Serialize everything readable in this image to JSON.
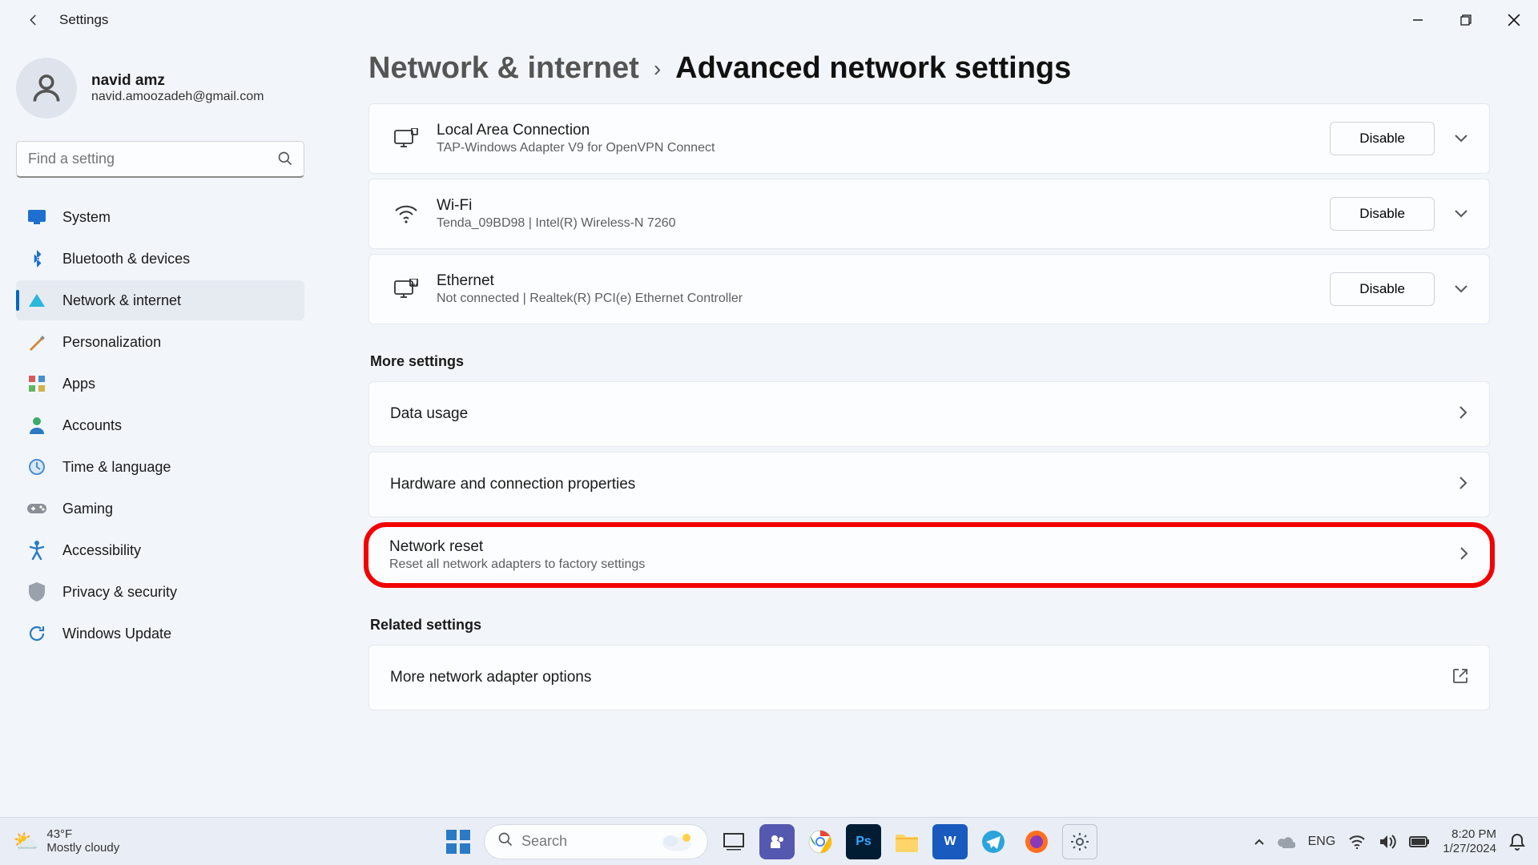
{
  "window": {
    "title": "Settings"
  },
  "profile": {
    "name": "navid amz",
    "email": "navid.amoozadeh@gmail.com"
  },
  "search": {
    "placeholder": "Find a setting"
  },
  "sidebar": {
    "items": [
      {
        "label": "System"
      },
      {
        "label": "Bluetooth & devices"
      },
      {
        "label": "Network & internet"
      },
      {
        "label": "Personalization"
      },
      {
        "label": "Apps"
      },
      {
        "label": "Accounts"
      },
      {
        "label": "Time & language"
      },
      {
        "label": "Gaming"
      },
      {
        "label": "Accessibility"
      },
      {
        "label": "Privacy & security"
      },
      {
        "label": "Windows Update"
      }
    ]
  },
  "breadcrumb": {
    "parent": "Network & internet",
    "current": "Advanced network settings"
  },
  "adapters": [
    {
      "title": "Local Area Connection",
      "subtitle": "TAP-Windows Adapter V9 for OpenVPN Connect",
      "action": "Disable"
    },
    {
      "title": "Wi-Fi",
      "subtitle": "Tenda_09BD98 | Intel(R) Wireless-N 7260",
      "action": "Disable"
    },
    {
      "title": "Ethernet",
      "subtitle": "Not connected | Realtek(R) PCI(e) Ethernet Controller",
      "action": "Disable"
    }
  ],
  "sections": {
    "more": "More settings",
    "related": "Related settings"
  },
  "more_rows": [
    {
      "title": "Data usage"
    },
    {
      "title": "Hardware and connection properties"
    },
    {
      "title": "Network reset",
      "subtitle": "Reset all network adapters to factory settings"
    }
  ],
  "related_rows": [
    {
      "title": "More network adapter options"
    }
  ],
  "taskbar": {
    "weather": {
      "temp": "43°F",
      "cond": "Mostly cloudy"
    },
    "search_placeholder": "Search",
    "lang": "ENG",
    "time": "8:20 PM",
    "date": "1/27/2024"
  }
}
